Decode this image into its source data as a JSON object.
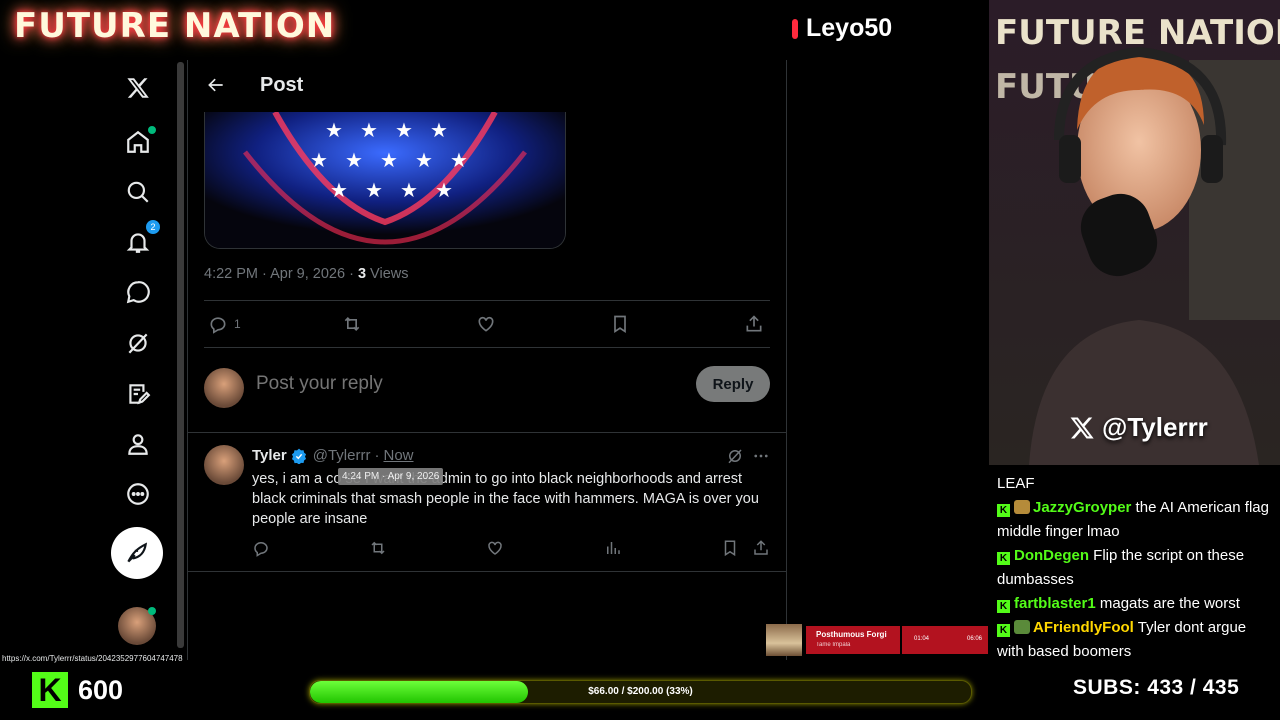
{
  "overlay": {
    "logo_text": "FUTURE NATION",
    "streamer_name": "Leyo50",
    "x_handle": "@Tylerrr",
    "kick_count": "600",
    "subs_label": "SUBS:",
    "subs_value": "433 / 435",
    "goal_text": "$66.00 / $200.00 (33%)",
    "goal_fraction": 0.33
  },
  "sidebar": {
    "notification_count": "2",
    "items": [
      "x-logo",
      "home",
      "explore",
      "notifications",
      "messages",
      "grok",
      "premium",
      "profile",
      "more"
    ]
  },
  "post": {
    "header_title": "Post",
    "timestamp": "4:22 PM · Apr 9, 2026 · ",
    "views_count": "3",
    "views_label": " Views",
    "reply_count": "1",
    "reply_placeholder": "Post your reply",
    "reply_button": "Reply"
  },
  "reply_tweet": {
    "name": "Tyler",
    "handle": "@Tylerrr",
    "separator": " · ",
    "time": "Now",
    "tooltip": "4:24 PM · Apr 9, 2026",
    "text": "yes, i am a co      se I want the admin to go into black neighborhoods and arrest black criminals that smash people in the face with hammers. MAGA is over you people are insane"
  },
  "chat": [
    {
      "user": "",
      "message": "LEAF",
      "color": "#ffffff"
    },
    {
      "user": "JazzyGroyper",
      "message": " the AI American flag middle finger lmao",
      "color": "#53fc18"
    },
    {
      "user": "DonDegen",
      "message": " Flip the script on these dumbasses",
      "color": "#53fc18"
    },
    {
      "user": "fartblaster1",
      "message": " magats are the worst",
      "color": "#53fc18"
    },
    {
      "user": "AFriendlyFool",
      "message": " Tyler dont argue with based boomers",
      "color": "#ffd700"
    }
  ],
  "now_playing": {
    "song": "Posthumous Forgi",
    "artist": "Tame Impala",
    "elapsed": "01:04",
    "total": "06:06"
  },
  "status_url": "https://x.com/Tylerrr/status/2042352977604747478"
}
